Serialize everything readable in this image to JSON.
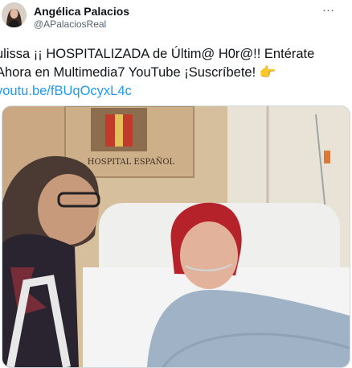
{
  "tweet": {
    "author_name": "Angélica Palacios",
    "author_handle": "@APalaciosReal",
    "more_icon": "…",
    "text_lines": [
      "ulissa ¡¡ HOSPITALIZADA de Últim@ H0r@!! Entérate",
      "Ahora en Multimedia7 YouTube ¡Suscríbete!"
    ],
    "pointing_emoji": "👉",
    "link_text": "youtu.be/fBUqOcyxL4c"
  },
  "media": {
    "wall_sign_text": "HOSPITAL ESPAÑOL"
  },
  "colors": {
    "link": "#1d9bf0",
    "text": "#0f1419",
    "secondary": "#536471"
  }
}
